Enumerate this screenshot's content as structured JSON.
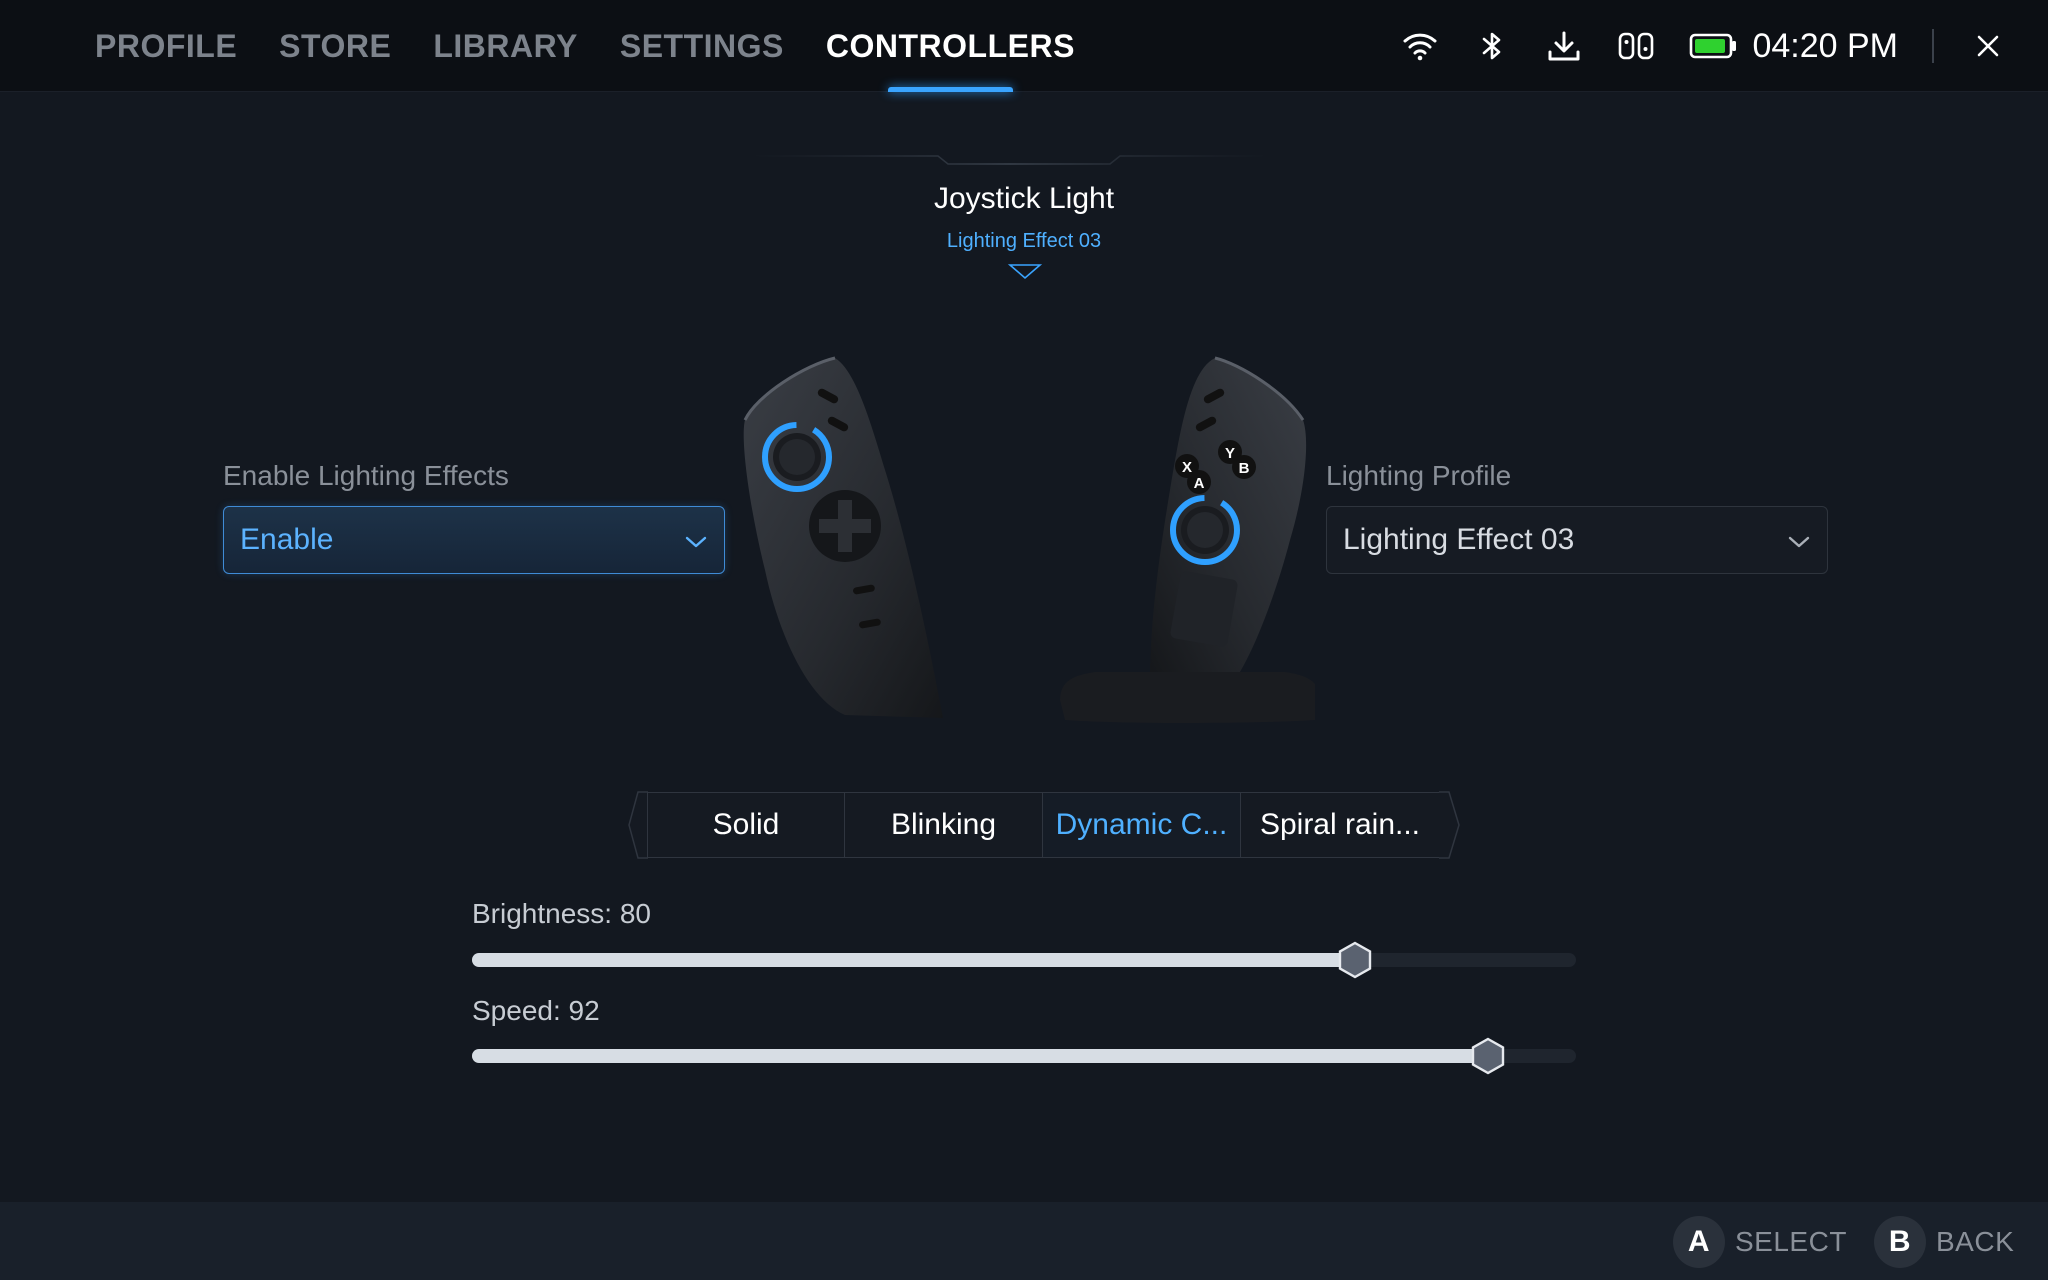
{
  "nav": {
    "tabs": [
      {
        "label": "PROFILE"
      },
      {
        "label": "STORE"
      },
      {
        "label": "LIBRARY"
      },
      {
        "label": "SETTINGS"
      },
      {
        "label": "CONTROLLERS"
      }
    ],
    "active_tab": "CONTROLLERS"
  },
  "status": {
    "time": "04:20 PM",
    "icons": [
      "wifi-icon",
      "bluetooth-icon",
      "download-icon",
      "controller-icon",
      "battery-icon",
      "close-icon"
    ],
    "battery_color": "#2fd12f"
  },
  "section": {
    "title": "Joystick Light",
    "subtitle": "Lighting Effect 03"
  },
  "enable_field": {
    "label": "Enable Lighting Effects",
    "value": "Enable"
  },
  "profile_field": {
    "label": "Lighting Profile",
    "value": "Lighting Effect 03"
  },
  "modes": {
    "items": [
      {
        "label": "Solid"
      },
      {
        "label": "Blinking"
      },
      {
        "label": "Dynamic C..."
      },
      {
        "label": "Spiral rain..."
      }
    ],
    "active": "Dynamic C..."
  },
  "sliders": {
    "brightness": {
      "label": "Brightness: 80",
      "value": 80,
      "max": 100
    },
    "speed": {
      "label": "Speed: 92",
      "value": 92,
      "max": 100
    }
  },
  "footer": {
    "select": {
      "key": "A",
      "label": "SELECT"
    },
    "back": {
      "key": "B",
      "label": "BACK"
    }
  },
  "colors": {
    "accent": "#3aa4ff",
    "background": "#131820"
  }
}
